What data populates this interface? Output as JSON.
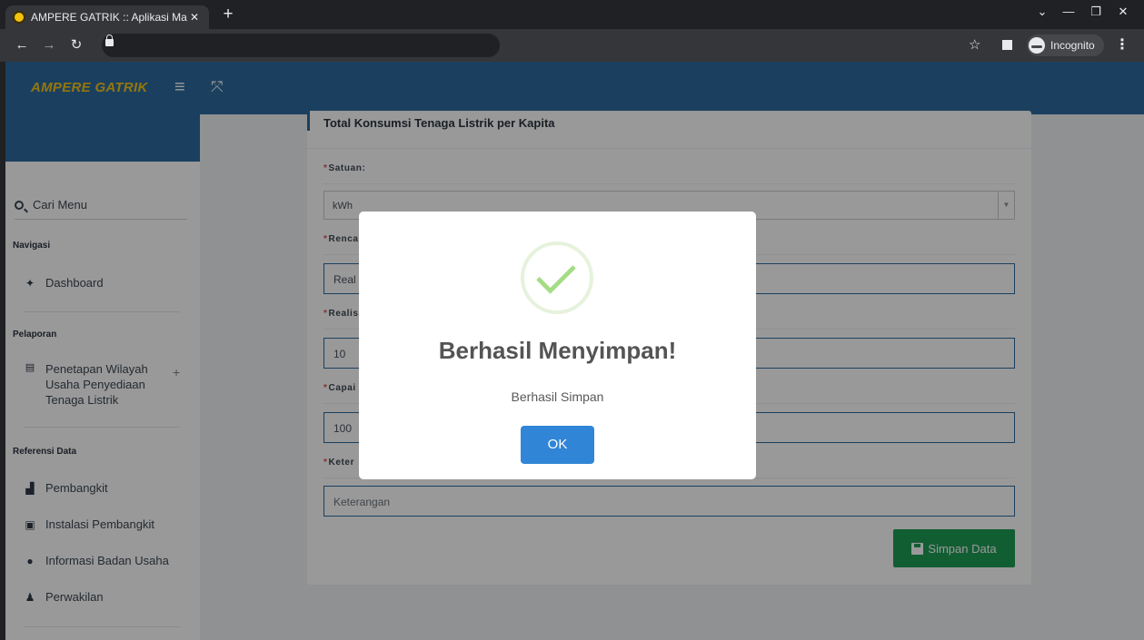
{
  "browser": {
    "tab_title": "AMPERE GATRIK :: Aplikasi Manaj",
    "tab_close": "✕",
    "new_tab": "+",
    "back": "←",
    "forward": "→",
    "reload": "↻",
    "star": "☆",
    "incognito_label": "Incognito",
    "menu": "⋮",
    "minimize": "—",
    "restore": "❐",
    "close": "✕",
    "chevron": "⌄"
  },
  "navbar": {
    "brand": "AMPERE GATRIK",
    "menu_icon": "≡",
    "expand_icon": "⤧"
  },
  "sidebar": {
    "search_label": "Cari Menu",
    "sections": [
      {
        "title": "Navigasi"
      },
      {
        "title": "Pelaporan"
      },
      {
        "title": "Referensi Data"
      }
    ],
    "items": [
      {
        "label": "Dashboard",
        "icon": "home-icon",
        "glyph": "✦"
      },
      {
        "label": "Penetapan Wilayah Usaha Penyediaan Tenaga Listrik",
        "icon": "document-icon",
        "glyph": "▤",
        "expand": "+"
      },
      {
        "label": "Pembangkit",
        "icon": "industry-icon",
        "glyph": "▟"
      },
      {
        "label": "Instalasi Pembangkit",
        "icon": "installation-icon",
        "glyph": "▣"
      },
      {
        "label": "Informasi Badan Usaha",
        "icon": "info-icon",
        "glyph": "●"
      },
      {
        "label": "Perwakilan",
        "icon": "user-icon",
        "glyph": "♟"
      }
    ]
  },
  "form": {
    "title": "Total Konsumsi Tenaga Listrik per Kapita",
    "required_mark": "*",
    "fields": [
      {
        "label": "Satuan:",
        "value": "kWh",
        "type": "select"
      },
      {
        "label": "Renca",
        "value": "Real",
        "type": "input"
      },
      {
        "label": "Realis",
        "value": "10",
        "type": "input"
      },
      {
        "label": "Capai",
        "value": "100",
        "type": "input"
      },
      {
        "label": "Keter",
        "value": "Keterangan",
        "type": "input"
      }
    ],
    "select_arrow": "▼",
    "save_label": "Simpan Data"
  },
  "modal": {
    "title": "Berhasil Menyimpan!",
    "text": "Berhasil Simpan",
    "ok_label": "OK",
    "icon": "success-check-icon"
  },
  "colors": {
    "navbar": "#2e6b9e",
    "brand": "#f7c516",
    "save_button": "#1f9d55",
    "ok_button": "#3085d6",
    "success": "#a5dc86"
  }
}
